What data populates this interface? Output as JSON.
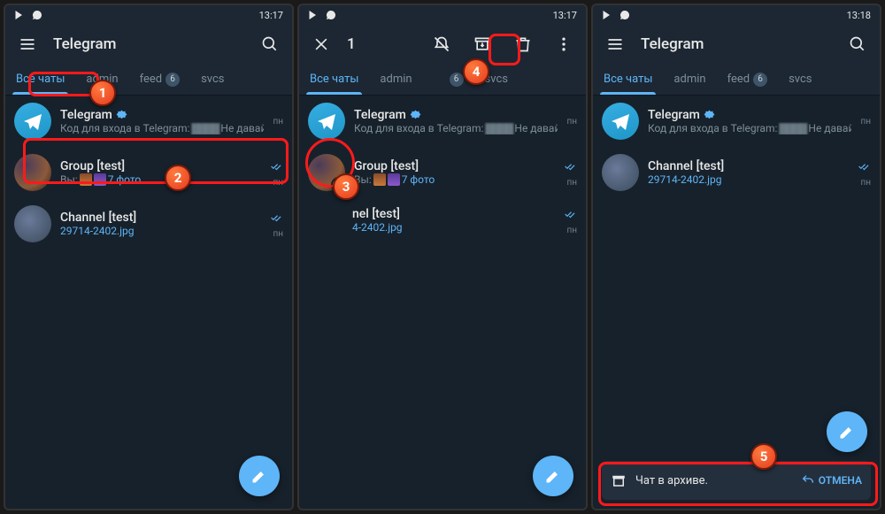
{
  "status": {
    "time_a": "13:17",
    "time_b": "13:17",
    "time_c": "13:18"
  },
  "screen1": {
    "app_title": "Telegram",
    "tabs": {
      "all": "Все чаты",
      "admin": "admin",
      "feed": "feed",
      "feed_badge": "6",
      "svcs": "svcs"
    },
    "chats": {
      "tg": {
        "name": "Telegram",
        "sub": "Код для входа в Telegram: ",
        "sub2": " Не давайте...",
        "time": "пн"
      },
      "grp": {
        "name": "Group [test]",
        "sub_pre": "Вы: ",
        "sub_link": "7 фото",
        "time": "пн"
      },
      "ch": {
        "name": "Channel [test]",
        "sub_link": "29714-2402.jpg",
        "time": "пн"
      }
    }
  },
  "screen2": {
    "sel_count": "1",
    "tabs": {
      "all": "Все чаты",
      "admin": "admin",
      "feed_badge": "6",
      "svcs": "svcs"
    },
    "chats": {
      "tg": {
        "name": "Telegram",
        "sub": "Код для входа в Telegram: ",
        "sub2": " Не давайте...",
        "time": "пн"
      },
      "grp": {
        "name": "Group [test]",
        "sub_pre": "Вы: ",
        "sub_link": "7 фото",
        "time": "пн"
      },
      "ch": {
        "name": "nel [test]",
        "sub_link": "4-2402.jpg",
        "time": "пн"
      }
    }
  },
  "screen3": {
    "app_title": "Telegram",
    "tabs": {
      "all": "Все чаты",
      "admin": "admin",
      "feed": "feed",
      "feed_badge": "6",
      "svcs": "svcs"
    },
    "chats": {
      "tg": {
        "name": "Telegram",
        "sub": "Код для входа в Telegram: ",
        "sub2": " Не давайте...",
        "time": "пн"
      },
      "ch": {
        "name": "Channel [test]",
        "sub_link": "29714-2402.jpg",
        "time": "пн"
      }
    },
    "snackbar": {
      "text": "Чат в архиве.",
      "undo": "ОТМЕНА"
    }
  },
  "markers": {
    "m1": "1",
    "m2": "2",
    "m3": "3",
    "m4": "4",
    "m5": "5"
  }
}
